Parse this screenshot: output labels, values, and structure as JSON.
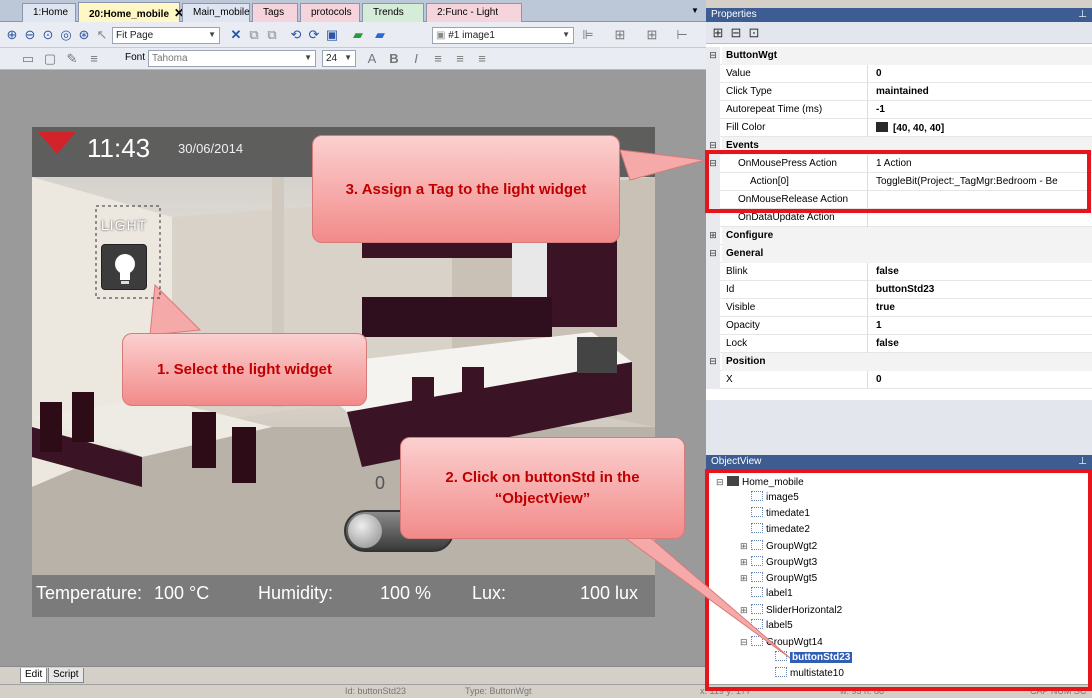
{
  "tabs": [
    {
      "label": "1:Home",
      "color": "#dfe6f2"
    },
    {
      "label": "20:Home_mobile",
      "color": "#fff7c4",
      "active": true
    },
    {
      "label": "Main_mobile",
      "color": "#dfe6f2"
    },
    {
      "label": "Tags",
      "color": "#f6d4dc"
    },
    {
      "label": "protocols",
      "color": "#f6d4dc"
    },
    {
      "label": "Trends",
      "color": "#d4ecd8"
    },
    {
      "label": "2:Func - Light",
      "color": "#f6d4dc"
    }
  ],
  "toolbar": {
    "zoom_value": "Fit Page",
    "image_dropdown": "#1 image1",
    "font_label": "Font",
    "font_value": "Tahoma",
    "font_size": "24",
    "icons": [
      "zoom-in-icon",
      "zoom-out-icon",
      "zoom-fit-icon",
      "zoom-actual-icon",
      "zoom-area-icon",
      "pointer-icon"
    ],
    "icons2": [
      "delete-icon",
      "copy-icon",
      "paste-icon",
      "rotate-left-icon",
      "rotate-right-icon",
      "layer-icon",
      "fill-color-icon",
      "border-color-icon",
      "image-icon"
    ]
  },
  "screen": {
    "time": "11:43",
    "date": "30/06/2014",
    "light_label": "LIGHT",
    "slider_value": "0",
    "temperature_label": "Temperature:",
    "temperature_value": "100 °C",
    "humidity_label": "Humidity:",
    "humidity_value": "100 %",
    "lux_label": "Lux:",
    "lux_value": "100 lux"
  },
  "bottom_tabs": [
    "Edit",
    "Script"
  ],
  "statusbar": [
    "Id: buttonStd23",
    "Type: ButtonWgt",
    "x: 119  y: 177",
    "w: 93  h: 88",
    "CAP NUM SC"
  ],
  "properties": {
    "title": "Properties",
    "rows": [
      {
        "gut": "⊟",
        "name": "ButtonWgt",
        "value": "",
        "cat": true
      },
      {
        "gut": "",
        "name": "Value",
        "value": "0"
      },
      {
        "gut": "",
        "name": "Click Type",
        "value": "maintained"
      },
      {
        "gut": "",
        "name": "Autorepeat Time (ms)",
        "value": "-1"
      },
      {
        "gut": "",
        "name": "Fill Color",
        "value": "[40, 40, 40]",
        "swatch": "#282828"
      },
      {
        "gut": "⊟",
        "name": "Events",
        "value": "",
        "cat": true
      },
      {
        "gut": "⊟",
        "name": "OnMousePress Action",
        "value": "1 Action",
        "normal": true,
        "indent": 1
      },
      {
        "gut": "",
        "name": "Action[0]",
        "value": "ToggleBit(Project:_TagMgr:Bedroom - Be",
        "normal": true,
        "indent": 2
      },
      {
        "gut": "",
        "name": "OnMouseRelease Action",
        "value": "",
        "normal": true,
        "indent": 1
      },
      {
        "gut": "",
        "name": "OnDataUpdate Action",
        "value": "",
        "normal": true,
        "indent": 1
      },
      {
        "gut": "⊞",
        "name": "Configure",
        "value": "",
        "cat": true
      },
      {
        "gut": "⊟",
        "name": "General",
        "value": "",
        "cat": true
      },
      {
        "gut": "",
        "name": "Blink",
        "value": "false"
      },
      {
        "gut": "",
        "name": "Id",
        "value": "buttonStd23"
      },
      {
        "gut": "",
        "name": "Visible",
        "value": "true"
      },
      {
        "gut": "",
        "name": "Opacity",
        "value": "1"
      },
      {
        "gut": "",
        "name": "Lock",
        "value": "false"
      },
      {
        "gut": "⊟",
        "name": "Position",
        "value": "",
        "cat": true
      },
      {
        "gut": "",
        "name": "X",
        "value": "0"
      }
    ]
  },
  "objectview": {
    "title": "ObjectView",
    "nodes": [
      {
        "label": "Home_mobile",
        "expand": "⊟",
        "level": 0
      },
      {
        "label": "image5",
        "level": 1
      },
      {
        "label": "timedate1",
        "level": 1
      },
      {
        "label": "timedate2",
        "level": 1
      },
      {
        "label": "GroupWgt2",
        "expand": "⊞",
        "level": 1
      },
      {
        "label": "GroupWgt3",
        "expand": "⊞",
        "level": 1
      },
      {
        "label": "GroupWgt5",
        "expand": "⊞",
        "level": 1
      },
      {
        "label": "label1",
        "level": 1
      },
      {
        "label": "SliderHorizontal2",
        "expand": "⊞",
        "level": 1
      },
      {
        "label": "label5",
        "level": 1
      },
      {
        "label": "GroupWgt14",
        "expand": "⊟",
        "level": 1
      },
      {
        "label": "buttonStd23",
        "level": 2,
        "selected": true
      },
      {
        "label": "multistate10",
        "level": 2
      }
    ]
  },
  "callouts": {
    "step1": "1. Select the light widget",
    "step2": "2. Click on buttonStd in the “ObjectView”",
    "step3": "3. Assign a Tag to the light widget"
  },
  "colors": {
    "highlight": "#e8141c",
    "selection": "#2f5fb5",
    "panel_title": "#3d5c92"
  }
}
